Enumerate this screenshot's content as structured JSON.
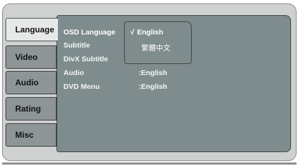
{
  "tabs": [
    {
      "label": "Language",
      "active": true
    },
    {
      "label": "Video",
      "active": false
    },
    {
      "label": "Audio",
      "active": false
    },
    {
      "label": "Rating",
      "active": false
    },
    {
      "label": "Misc",
      "active": false
    }
  ],
  "menu": {
    "rows": [
      {
        "label": "OSD Language",
        "value": ""
      },
      {
        "label": "Subtitle",
        "value": ""
      },
      {
        "label": "DivX Subtitle",
        "value": ""
      },
      {
        "label": "Audio",
        "value": ":English"
      },
      {
        "label": "DVD Menu",
        "value": ":English"
      }
    ],
    "popup": {
      "check_mark": "√",
      "options": [
        "English",
        "繁體中文"
      ],
      "selected_index": 0
    }
  },
  "colors": {
    "frame_bg": "#cfd1d1",
    "panel_bg": "#7f8c8e",
    "tab_bg": "#8d9596",
    "tab_active_bg": "#e6e9e8"
  }
}
